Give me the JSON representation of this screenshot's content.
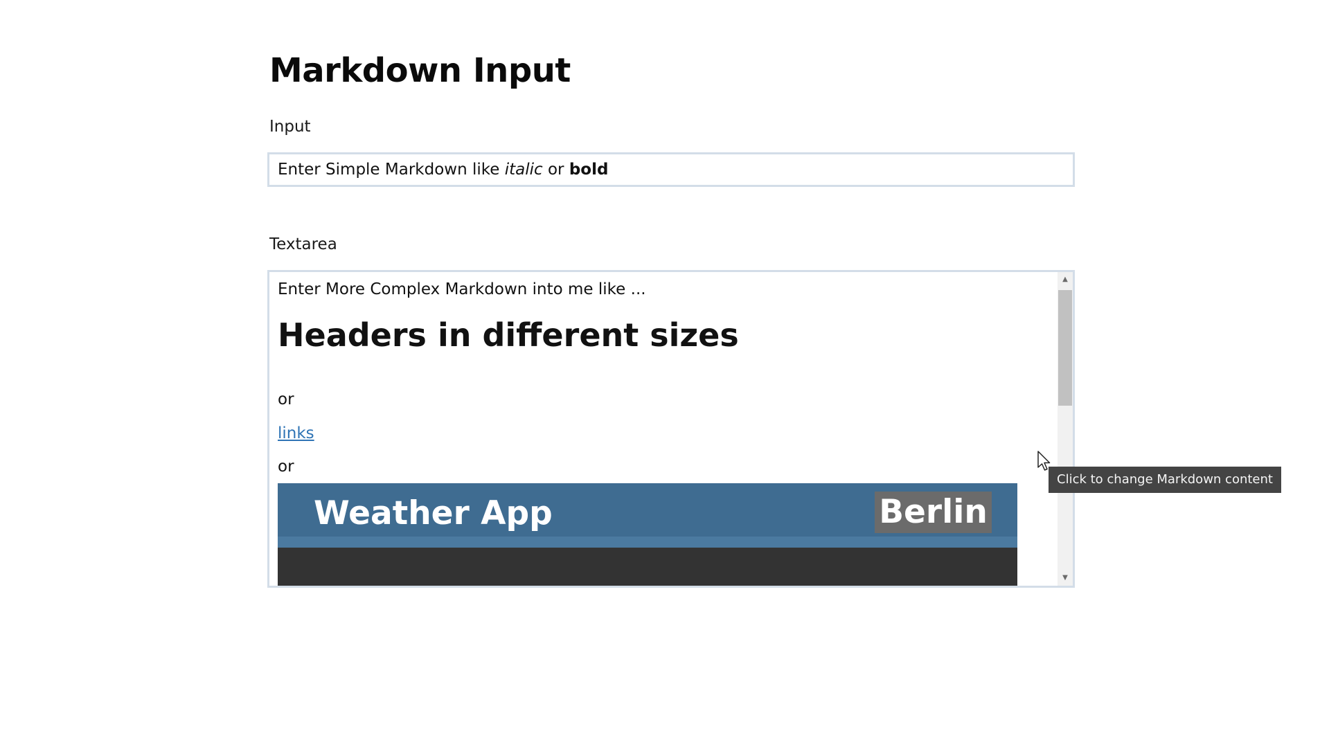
{
  "page": {
    "title": "Markdown Input"
  },
  "input_section": {
    "label": "Input",
    "value_prefix": "Enter Simple Markdown like ",
    "value_italic": "italic",
    "value_middle": " or ",
    "value_bold": "bold"
  },
  "textarea_section": {
    "label": "Textarea",
    "intro": "Enter More Complex Markdown into me like ...",
    "heading": "Headers in different sizes",
    "or_1": "or",
    "link_text": "links",
    "or_2": "or",
    "image": {
      "app_title": "Weather App",
      "city": "Berlin"
    }
  },
  "tooltip": {
    "text": "Click to change Markdown content"
  },
  "icons": {
    "scroll_up": "scroll-up-arrow",
    "scroll_down": "scroll-down-arrow",
    "cursor": "mouse-pointer"
  },
  "colors": {
    "field_border": "#d3dde8",
    "link": "#2f74b5",
    "weather_bar": "#3f6c91",
    "weather_dark": "#333333",
    "city_badge": "#6b6b6b",
    "tooltip_bg": "#444444"
  }
}
